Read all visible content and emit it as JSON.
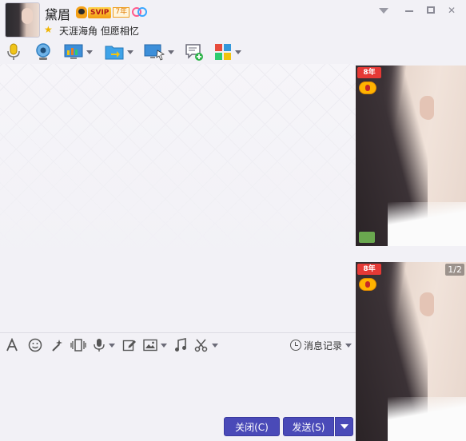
{
  "header": {
    "contact_name": "黛眉",
    "vip_label": "SVIP",
    "vip_years": "7",
    "vip_year_unit": "年",
    "signature": "天涯海角 但愿相忆"
  },
  "input_toolbar": {
    "history_label": "消息记录"
  },
  "buttons": {
    "close_label": "关闭(C)",
    "send_label": "发送(S)"
  },
  "side_panel": {
    "level_badge": "8年",
    "page_counter": "1/2"
  },
  "colors": {
    "button_bg": "#4a4ab8",
    "background": "#f2f1f6",
    "level_badge": "#e53935"
  }
}
